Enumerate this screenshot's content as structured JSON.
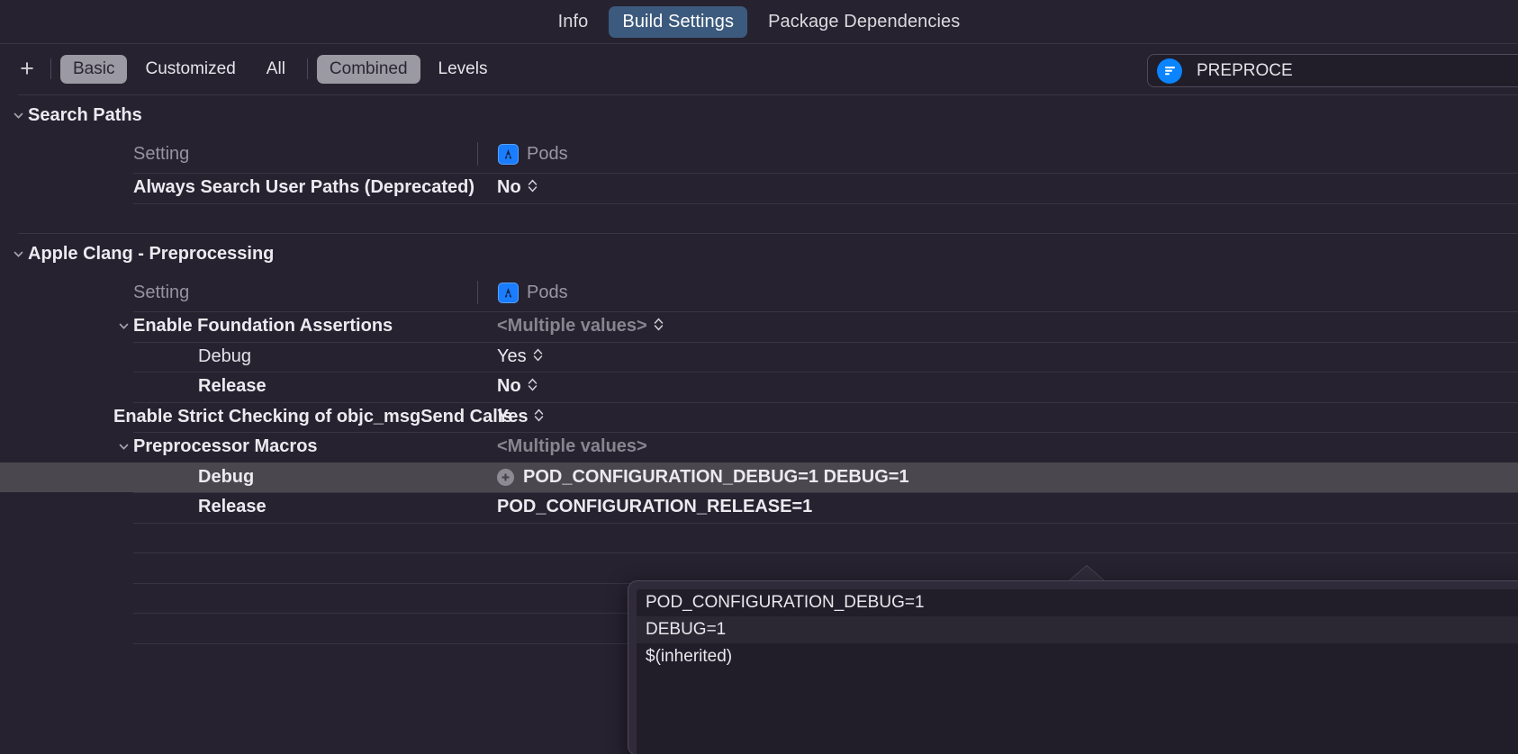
{
  "tabs": [
    {
      "label": "Info",
      "active": false
    },
    {
      "label": "Build Settings",
      "active": true
    },
    {
      "label": "Package Dependencies",
      "active": false
    }
  ],
  "toolbar": {
    "add_label": "+",
    "add_icon": "plus-icon",
    "scope_segments": [
      {
        "label": "Basic",
        "selected": true
      },
      {
        "label": "Customized",
        "selected": false
      },
      {
        "label": "All",
        "selected": false
      }
    ],
    "level_segments": [
      {
        "label": "Combined",
        "selected": true
      },
      {
        "label": "Levels",
        "selected": false
      }
    ]
  },
  "search": {
    "value": "PREPROCE",
    "icon": "filter-icon",
    "icon_color": "#0a84ff"
  },
  "columns": {
    "setting_label": "Setting",
    "target_label": "Pods",
    "target_icon": "xcode-project-icon"
  },
  "groups": [
    {
      "title": "Search Paths",
      "expanded": true,
      "rows": [
        {
          "name": "Always Search User Paths (Deprecated)",
          "indent": 0,
          "bold": true,
          "twisty": "",
          "value": "No",
          "value_style": "bold",
          "stepper": true,
          "selected": false,
          "plus_badge": false
        }
      ],
      "empty_rows": 1
    },
    {
      "title": "Apple Clang - Preprocessing",
      "expanded": true,
      "rows": [
        {
          "name": "Enable Foundation Assertions",
          "indent": 1,
          "bold": true,
          "twisty": "chevron-down-icon",
          "value": "<Multiple values>",
          "value_style": "multiple",
          "stepper": true,
          "selected": false,
          "plus_badge": false
        },
        {
          "name": "Debug",
          "indent": 2,
          "bold": false,
          "twisty": "",
          "value": "Yes",
          "value_style": "regular",
          "stepper": true,
          "selected": false,
          "plus_badge": false
        },
        {
          "name": "Release",
          "indent": 2,
          "bold": true,
          "twisty": "",
          "value": "No",
          "value_style": "bold",
          "stepper": true,
          "selected": false,
          "plus_badge": false
        },
        {
          "name": "Enable Strict Checking of objc_msgSend Calls",
          "indent": 1,
          "bold": true,
          "twisty": "",
          "value": "Yes",
          "value_style": "bold",
          "stepper": true,
          "selected": false,
          "plus_badge": false
        },
        {
          "name": "Preprocessor Macros",
          "indent": 1,
          "bold": true,
          "twisty": "chevron-down-icon",
          "value": "<Multiple values>",
          "value_style": "multiple",
          "stepper": false,
          "selected": false,
          "plus_badge": false
        },
        {
          "name": "Debug",
          "indent": 2,
          "bold": true,
          "twisty": "",
          "value": "POD_CONFIGURATION_DEBUG=1 DEBUG=1",
          "value_style": "bold",
          "stepper": false,
          "selected": true,
          "plus_badge": true
        },
        {
          "name": "Release",
          "indent": 2,
          "bold": true,
          "twisty": "",
          "value": "POD_CONFIGURATION_RELEASE=1",
          "value_style": "bold",
          "stepper": false,
          "selected": false,
          "plus_badge": false
        }
      ],
      "empty_rows": 5
    }
  ],
  "popover": {
    "entries": [
      "POD_CONFIGURATION_DEBUG=1",
      "DEBUG=1",
      "$(inherited)"
    ]
  },
  "colors": {
    "background": "#262230",
    "selected_row": "#4a474f",
    "tab_accent": "#3c5a7d",
    "segment_on": "#9b99a1",
    "icon_blue": "#0a84ff",
    "separator": "#393444"
  }
}
